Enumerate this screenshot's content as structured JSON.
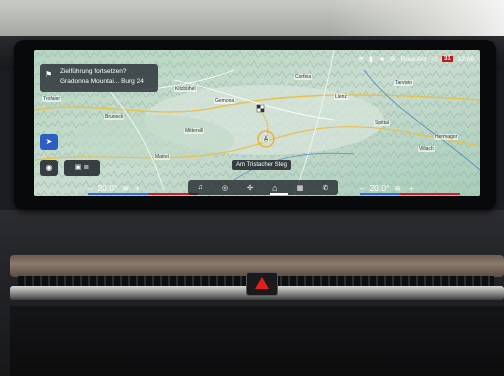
{
  "status_bar": {
    "source": "Rock Ant",
    "time": "12:06",
    "calendar": "31"
  },
  "nav_card": {
    "question": "Zielführung fortsetzen?",
    "address": "Gradonna Mountai... Burg 24"
  },
  "map": {
    "road_label": "Am Tristacher Steg",
    "places": [
      "Trofaier",
      "Kitzbühel",
      "Mittersill",
      "Matrei",
      "Lienz",
      "Spittal",
      "Villach",
      "Bruneck",
      "Cortina",
      "Hermagor",
      "Tarvisio",
      "Gemona"
    ]
  },
  "climate_left": {
    "minus": "–",
    "temp": "20.0°",
    "plus": "+"
  },
  "climate_right": {
    "minus": "–",
    "temp": "20.0°",
    "plus": "+"
  },
  "dock": {
    "icons": [
      "music-icon",
      "media-icon",
      "fan-icon",
      "home-icon",
      "apps-icon",
      "phone-icon"
    ]
  },
  "colors": {
    "accent_blue": "#2c5fbf",
    "warm_red": "#d21d2b",
    "cool_blue": "#2f6fe0"
  }
}
